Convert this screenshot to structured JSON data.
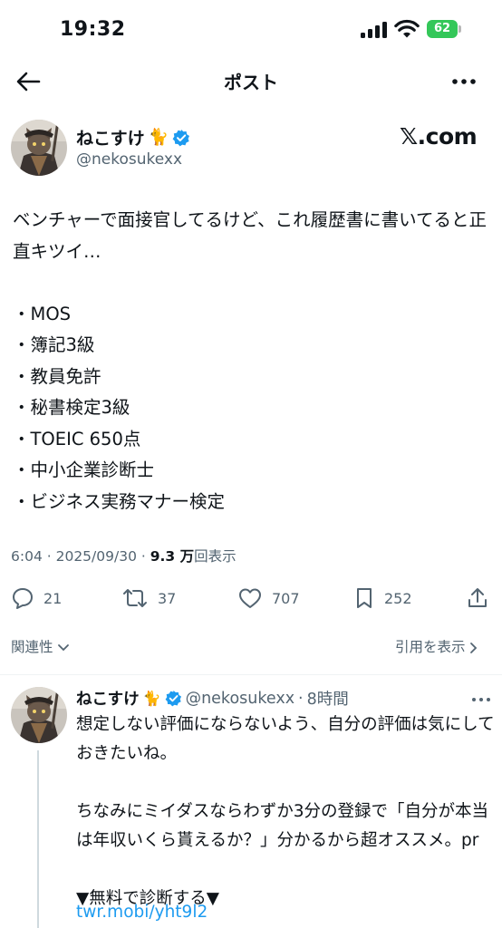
{
  "status_bar": {
    "time": "19:32",
    "battery": "62"
  },
  "header": {
    "title": "ポスト"
  },
  "post": {
    "author_name": "ねこすけ",
    "author_emoji": "🐈",
    "handle": "@nekosukexx",
    "source_logo": "𝕏.com",
    "body": "ベンチャーで面接官してるけど、これ履歴書に書いてると正直キツイ…\n\n・MOS\n・簿記3級\n・教員免許\n・秘書検定3級\n・TOEIC 650点\n・中小企業診断士\n・ビジネス実務マナー検定",
    "time": "6:04",
    "date": "2025/09/30",
    "views_value": "9.3 万",
    "views_label": "回表示",
    "replies": "21",
    "reposts": "37",
    "likes": "707",
    "bookmarks": "252"
  },
  "filters": {
    "related": "関連性",
    "show_quotes": "引用を表示"
  },
  "reply": {
    "author_name": "ねこすけ",
    "author_emoji": "🐈",
    "handle": "@nekosukexx",
    "time": "8時間",
    "body": "想定しない評価にならないよう、自分の評価は気にしておきたいね。\n\nちなみにミイダスならわずか3分の登録で「自分が本当は年収いくら貰えるか？」分かるから超オススメ。pr\n\n▼無料で診断する▼",
    "link": "twr.mobi/yht9l2"
  },
  "colors": {
    "accent": "#1d9bf0",
    "battery": "#34c759",
    "verified": "#1d9bf0"
  },
  "icons": [
    "back-arrow-icon",
    "more-icon",
    "verified-badge-icon",
    "reply-icon",
    "repost-icon",
    "like-icon",
    "bookmark-icon",
    "share-icon",
    "chevron-down-icon",
    "chevron-right-icon"
  ]
}
